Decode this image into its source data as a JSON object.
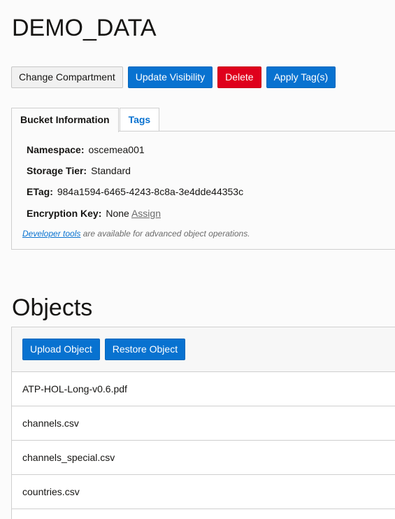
{
  "bucket": {
    "name": "DEMO_DATA"
  },
  "actions": {
    "change_compartment": "Change Compartment",
    "update_visibility": "Update Visibility",
    "delete": "Delete",
    "apply_tags": "Apply Tag(s)"
  },
  "tabs": {
    "bucket_information": "Bucket Information",
    "tags": "Tags"
  },
  "bucket_info": {
    "namespace_label": "Namespace:",
    "namespace_value": "oscemea001",
    "storage_tier_label": "Storage Tier:",
    "storage_tier_value": "Standard",
    "etag_label": "ETag:",
    "etag_value": "984a1594-6465-4243-8c8a-3e4dde44353c",
    "encryption_key_label": "Encryption Key:",
    "encryption_key_value": "None",
    "assign_link": "Assign",
    "developer_tools_link": "Developer tools",
    "developer_tools_note": " are available for advanced object operations."
  },
  "objects": {
    "title": "Objects",
    "upload_button": "Upload Object",
    "restore_button": "Restore Object",
    "items": [
      {
        "name": "ATP-HOL-Long-v0.6.pdf"
      },
      {
        "name": "channels.csv"
      },
      {
        "name": "channels_special.csv"
      },
      {
        "name": "countries.csv"
      }
    ]
  },
  "colors": {
    "primary": "#0872d0",
    "danger": "#df001c",
    "text": "#161513",
    "muted": "#6b6b6b"
  }
}
